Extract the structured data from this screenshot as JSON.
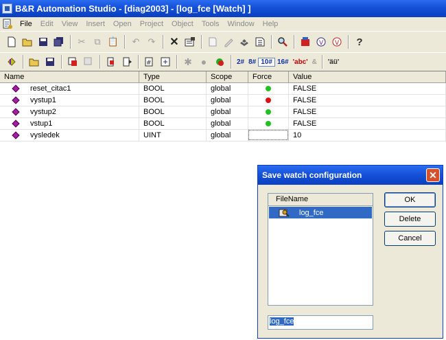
{
  "window": {
    "title": "B&R Automation Studio - [diag2003] - [log_fce [Watch] ]"
  },
  "menubar": {
    "items": [
      {
        "label": "File",
        "enabled": true
      },
      {
        "label": "Edit",
        "enabled": false
      },
      {
        "label": "View",
        "enabled": false
      },
      {
        "label": "Insert",
        "enabled": false
      },
      {
        "label": "Open",
        "enabled": false
      },
      {
        "label": "Project",
        "enabled": false
      },
      {
        "label": "Object",
        "enabled": false
      },
      {
        "label": "Tools",
        "enabled": false
      },
      {
        "label": "Window",
        "enabled": false
      },
      {
        "label": "Help",
        "enabled": false
      }
    ]
  },
  "toolbar2": {
    "base_labels": [
      "2#",
      "8#",
      "10#",
      "16#"
    ],
    "active_base": "10#",
    "text_abc": "'abc'",
    "text_and": "&",
    "text_au": "'äü'"
  },
  "grid": {
    "headers": {
      "name": "Name",
      "type": "Type",
      "scope": "Scope",
      "force": "Force",
      "value": "Value"
    },
    "rows": [
      {
        "name": "reset_citac1",
        "type": "BOOL",
        "scope": "global",
        "force": "green",
        "value": "FALSE"
      },
      {
        "name": "vystup1",
        "type": "BOOL",
        "scope": "global",
        "force": "red",
        "value": "FALSE"
      },
      {
        "name": "vystup2",
        "type": "BOOL",
        "scope": "global",
        "force": "green",
        "value": "FALSE"
      },
      {
        "name": "vstup1",
        "type": "BOOL",
        "scope": "global",
        "force": "green",
        "value": "FALSE"
      },
      {
        "name": "vysledek",
        "type": "UINT",
        "scope": "global",
        "force": "editor",
        "value": "10"
      }
    ]
  },
  "dialog": {
    "title": "Save watch configuration",
    "list_header": "FileName",
    "files": [
      "log_fce"
    ],
    "filename_value": "log_fce",
    "ok_label": "OK",
    "delete_label": "Delete",
    "cancel_label": "Cancel"
  },
  "colors": {
    "force_green": "#22c022",
    "force_red": "#e01010",
    "selection": "#316ac5"
  }
}
